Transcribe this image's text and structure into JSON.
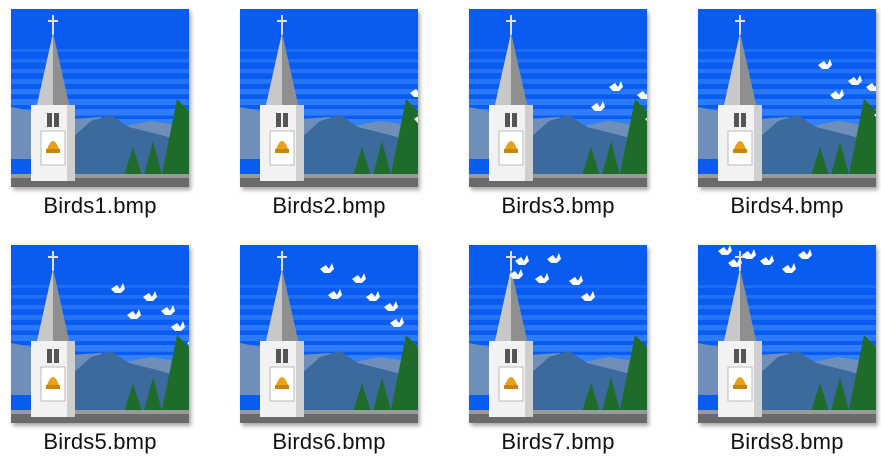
{
  "files": [
    {
      "name": "Birds1.bmp",
      "icon": "church-birds-thumbnail"
    },
    {
      "name": "Birds2.bmp",
      "icon": "church-birds-thumbnail"
    },
    {
      "name": "Birds3.bmp",
      "icon": "church-birds-thumbnail"
    },
    {
      "name": "Birds4.bmp",
      "icon": "church-birds-thumbnail"
    },
    {
      "name": "Birds5.bmp",
      "icon": "church-birds-thumbnail"
    },
    {
      "name": "Birds6.bmp",
      "icon": "church-birds-thumbnail"
    },
    {
      "name": "Birds7.bmp",
      "icon": "church-birds-thumbnail"
    },
    {
      "name": "Birds8.bmp",
      "icon": "church-birds-thumbnail"
    }
  ],
  "colors": {
    "sky": "#0a5cf0",
    "sky_stripe": "#3f8cff",
    "mountain": "#3d6a9c",
    "ridge": "#6f8fb8",
    "tree": "#1f6b2a",
    "steeple": "#c8c8c8",
    "bell": "#e7a21c"
  }
}
